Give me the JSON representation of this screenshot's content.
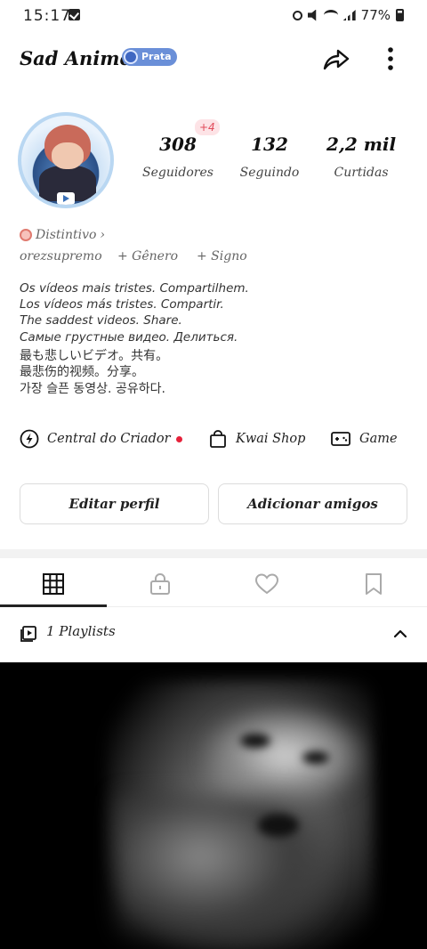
{
  "status_bar": {
    "time": "15:17",
    "battery": "77%"
  },
  "header": {
    "title": "Sad Anime",
    "badge": "Prata"
  },
  "stats": {
    "followers": {
      "value": "308",
      "label": "Seguidores",
      "new_badge": "+4"
    },
    "following": {
      "value": "132",
      "label": "Seguindo"
    },
    "likes": {
      "value": "2,2 mil",
      "label": "Curtidas"
    }
  },
  "profile": {
    "distintivo": "Distintivo",
    "username": "orezsupremo",
    "gender_action": "+ Gênero",
    "sign_action": "+ Signo",
    "bio_lines": [
      "Os vídeos mais tristes. Compartilhem.",
      "Los vídeos más tristes. Compartir.",
      "The saddest videos. Share.",
      "Самые грустные видео. Делиться.",
      "最も悲しいビデオ。共有。",
      "最悲伤的视频。分享。",
      "가장 슬픈 동영상. 공유하다."
    ]
  },
  "links": {
    "creator_center": "Central do Criador",
    "shop": "Kwai Shop",
    "game": "Game"
  },
  "buttons": {
    "edit_profile": "Editar perfil",
    "add_friends": "Adicionar amigos"
  },
  "tabs": [
    "grid-icon",
    "lock-icon",
    "heart-icon",
    "bookmark-icon"
  ],
  "playlists": {
    "label": "1 Playlists"
  },
  "colors": {
    "badge": "#6a8fd8",
    "notification_dot": "#e6213a",
    "new_followers": "#e14b5a"
  }
}
